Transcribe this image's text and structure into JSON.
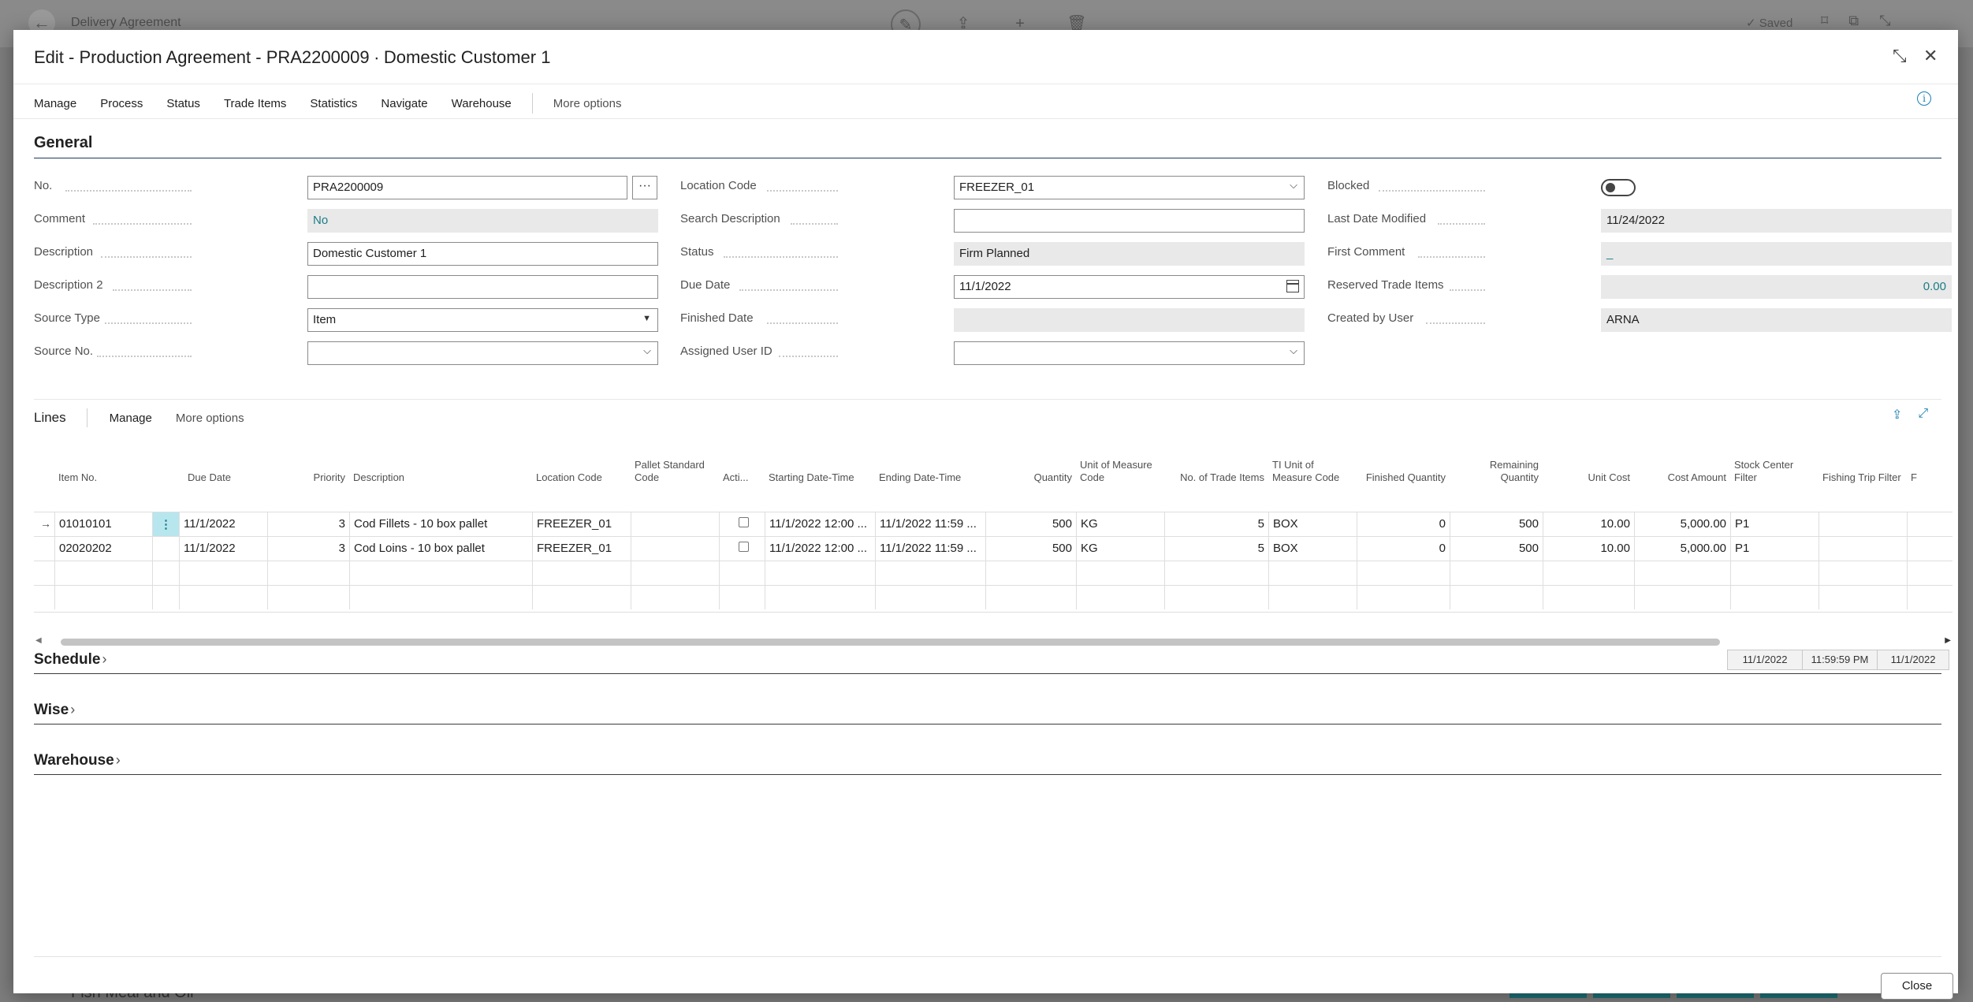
{
  "background": {
    "title": "Delivery Agreement",
    "saved": "Saved",
    "bottom_text": "Fish Meal and Oil"
  },
  "dialog": {
    "title": "Edit - Production Agreement - PRA2200009 ∙ Domestic Customer 1",
    "menu": [
      "Manage",
      "Process",
      "Status",
      "Trade Items",
      "Statistics",
      "Navigate",
      "Warehouse"
    ],
    "more_options": "More options",
    "close_button": "Close"
  },
  "general": {
    "title": "General",
    "col1": {
      "no_label": "No.",
      "no_value": "PRA2200009",
      "comment_label": "Comment",
      "comment_value": "No",
      "description_label": "Description",
      "description_value": "Domestic Customer 1",
      "description2_label": "Description 2",
      "description2_value": "",
      "source_type_label": "Source Type",
      "source_type_value": "Item",
      "source_no_label": "Source No.",
      "source_no_value": ""
    },
    "col2": {
      "location_code_label": "Location Code",
      "location_code_value": "FREEZER_01",
      "search_description_label": "Search Description",
      "search_description_value": "",
      "status_label": "Status",
      "status_value": "Firm Planned",
      "due_date_label": "Due Date",
      "due_date_value": "11/1/2022",
      "finished_date_label": "Finished Date",
      "finished_date_value": "",
      "assigned_user_label": "Assigned User ID",
      "assigned_user_value": ""
    },
    "col3": {
      "blocked_label": "Blocked",
      "last_date_modified_label": "Last Date Modified",
      "last_date_modified_value": "11/24/2022",
      "first_comment_label": "First Comment",
      "first_comment_value": "_",
      "reserved_trade_items_label": "Reserved Trade Items",
      "reserved_trade_items_value": "0.00",
      "created_by_user_label": "Created by User",
      "created_by_user_value": "ARNA"
    }
  },
  "lines": {
    "title": "Lines",
    "manage": "Manage",
    "more_options": "More options",
    "headers": [
      "Item No.",
      "Due Date",
      "Priority",
      "Description",
      "Location Code",
      "Pallet Standard Code",
      "Acti...",
      "Starting Date-Time",
      "Ending Date-Time",
      "Quantity",
      "Unit of Measure Code",
      "No. of Trade Items",
      "TI Unit of Measure Code",
      "Finished Quantity",
      "Remaining Quantity",
      "Unit Cost",
      "Cost Amount",
      "Stock Center Filter",
      "Fishing Trip Filter",
      "F"
    ],
    "rows": [
      {
        "item_no": "01010101",
        "due_date": "11/1/2022",
        "priority": "3",
        "description": "Cod Fillets - 10 box pallet",
        "location": "FREEZER_01",
        "pallet": "",
        "start": "11/1/2022 12:00 ...",
        "end": "11/1/2022 11:59 ...",
        "quantity": "500",
        "uom": "KG",
        "trade_items": "5",
        "ti_uom": "BOX",
        "finished": "0",
        "remaining": "500",
        "unit_cost": "10.00",
        "cost_amount": "5,000.00",
        "stock_center": "P1",
        "fishing_trip": ""
      },
      {
        "item_no": "02020202",
        "due_date": "11/1/2022",
        "priority": "3",
        "description": "Cod Loins - 10 box pallet",
        "location": "FREEZER_01",
        "pallet": "",
        "start": "11/1/2022 12:00 ...",
        "end": "11/1/2022 11:59 ...",
        "quantity": "500",
        "uom": "KG",
        "trade_items": "5",
        "ti_uom": "BOX",
        "finished": "0",
        "remaining": "500",
        "unit_cost": "10.00",
        "cost_amount": "5,000.00",
        "stock_center": "P1",
        "fishing_trip": ""
      }
    ]
  },
  "schedule": {
    "title": "Schedule",
    "summary": [
      "11/1/2022",
      "11:59:59 PM",
      "11/1/2022"
    ]
  },
  "wise": {
    "title": "Wise"
  },
  "warehouse": {
    "title": "Warehouse"
  }
}
